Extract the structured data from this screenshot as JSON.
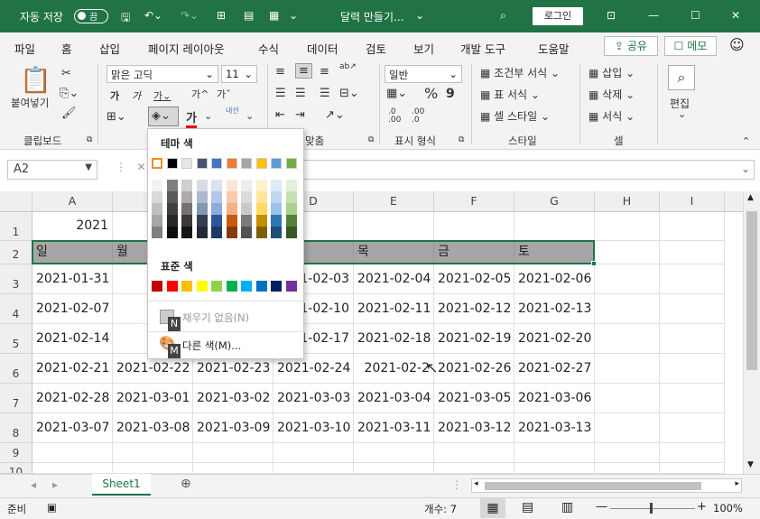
{
  "titlebar": {
    "autosave": "자동 저장",
    "toggle": "끔",
    "filename": "달력 만들기...",
    "login": "로그인"
  },
  "menu": [
    "파일",
    "홈",
    "삽입",
    "페이지 레이아웃",
    "수식",
    "데이터",
    "검토",
    "보기",
    "개발 도구",
    "도움말"
  ],
  "share": "공유",
  "memo": "메모",
  "ribbon": {
    "paste": "붙여넣기",
    "font_name": "맑은 고딕",
    "font_size": "11",
    "wrap": "내선",
    "number_format": "일반",
    "cond_format": "조건부 서식",
    "table_format": "표 서식",
    "cell_style": "셀 스타일",
    "insert": "삽입",
    "delete": "삭제",
    "format": "서식",
    "edit": "편집",
    "groups": [
      "클립보드",
      "맞춤",
      "표시 형식",
      "스타일",
      "셀"
    ]
  },
  "namebox": "A2",
  "fx": "fx",
  "columns": [
    "A",
    "B",
    "C",
    "D",
    "E",
    "F",
    "G",
    "H",
    "I"
  ],
  "rows": [
    "1",
    "2",
    "3",
    "4",
    "5",
    "6",
    "7",
    "8",
    "9",
    "10"
  ],
  "grid": {
    "r1": {
      "A": "2021"
    },
    "r2": {
      "A": "일",
      "B": "월",
      "E": "목",
      "F": "금",
      "G": "토"
    },
    "r3": {
      "A": "2021-01-31",
      "B": "2021",
      "D": "1-02-03",
      "E": "2021-02-04",
      "F": "2021-02-05",
      "G": "2021-02-06"
    },
    "r4": {
      "A": "2021-02-07",
      "B": "2021",
      "D": "1-02-10",
      "E": "2021-02-11",
      "F": "2021-02-12",
      "G": "2021-02-13"
    },
    "r5": {
      "A": "2021-02-14",
      "B": "2021",
      "D": "1-02-17",
      "E": "2021-02-18",
      "F": "2021-02-19",
      "G": "2021-02-20"
    },
    "r6": {
      "A": "2021-02-21",
      "B": "2021-02-22",
      "C": "2021-02-23",
      "D": "2021-02-24",
      "E": "2021-02-2",
      "F": "2021-02-26",
      "G": "2021-02-27"
    },
    "r7": {
      "A": "2021-02-28",
      "B": "2021-03-01",
      "C": "2021-03-02",
      "D": "2021-03-03",
      "E": "2021-03-04",
      "F": "2021-03-05",
      "G": "2021-03-06"
    },
    "r8": {
      "A": "2021-03-07",
      "B": "2021-03-08",
      "C": "2021-03-09",
      "D": "2021-03-10",
      "E": "2021-03-11",
      "F": "2021-03-12",
      "G": "2021-03-13"
    }
  },
  "popup": {
    "theme_title": "테마 색",
    "standard_title": "표준 색",
    "no_fill": "채우기 없음(N)",
    "more_colors": "다른 색(M)...",
    "key_n": "N",
    "key_m": "M",
    "theme_colors": [
      "#ffffff",
      "#000000",
      "#e7e6e6",
      "#44546a",
      "#4472c4",
      "#ed7d31",
      "#a5a5a5",
      "#ffc000",
      "#5b9bd5",
      "#70ad47"
    ],
    "standard_colors": [
      "#c00000",
      "#ff0000",
      "#ffc000",
      "#ffff00",
      "#92d050",
      "#00b050",
      "#00b0f0",
      "#0070c0",
      "#002060",
      "#7030a0"
    ]
  },
  "sheet_tab": "Sheet1",
  "status": {
    "ready": "준비",
    "count": "개수: 7",
    "zoom": "100%"
  }
}
